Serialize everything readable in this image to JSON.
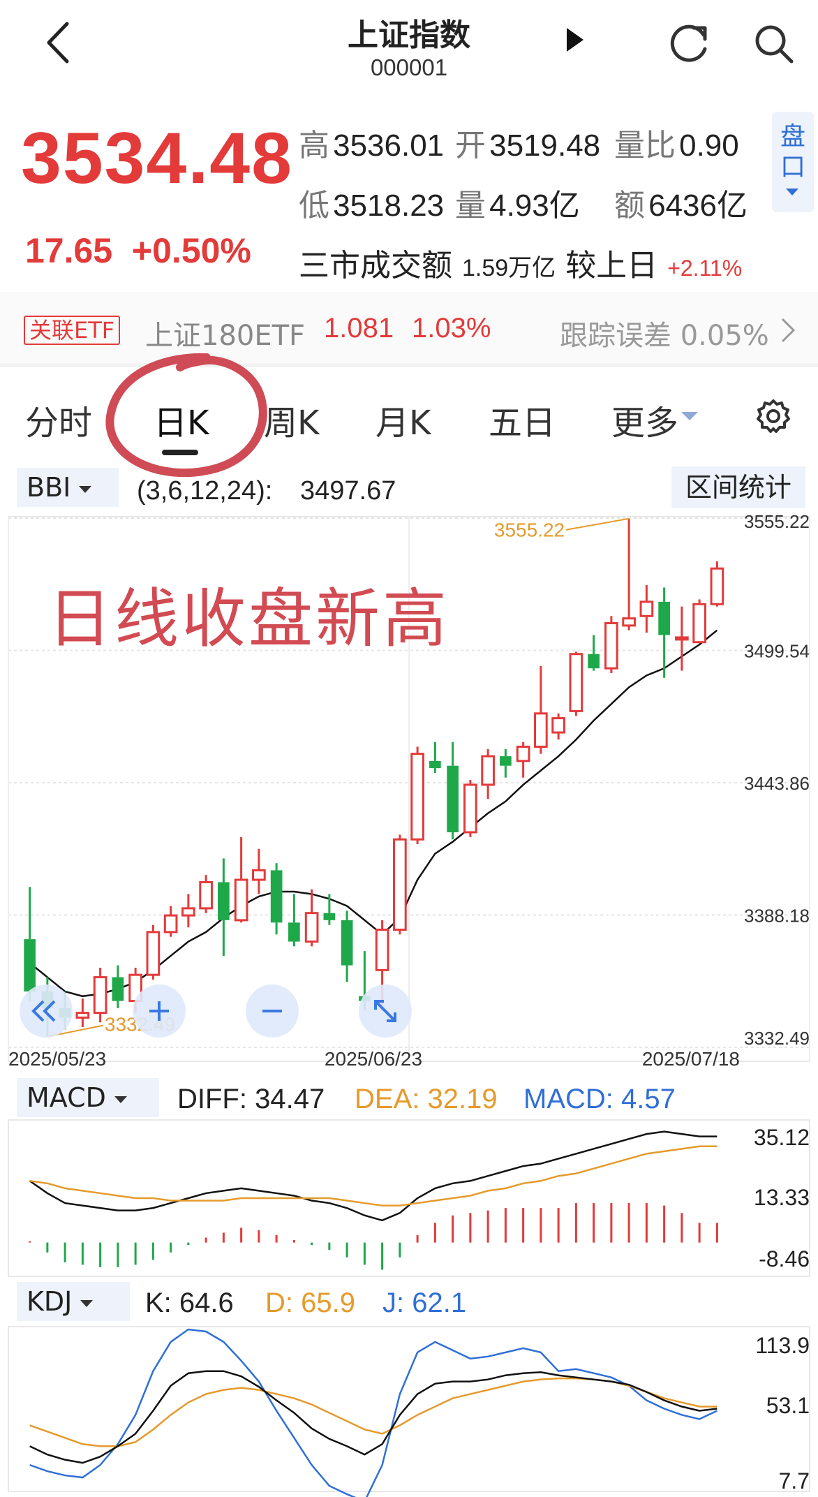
{
  "header": {
    "title": "上证指数",
    "code": "000001"
  },
  "quote": {
    "price": "3534.48",
    "change": "17.65",
    "change_pct": "+0.50%",
    "high_label": "高",
    "high": "3536.01",
    "open_label": "开",
    "open": "3519.48",
    "vol_ratio_label": "量比",
    "vol_ratio": "0.90",
    "low_label": "低",
    "low": "3518.23",
    "volume_label": "量",
    "volume": "4.93亿",
    "amount_label": "额",
    "amount": "6436亿",
    "turnover_label": "三市成交额",
    "turnover_value": "1.59万亿",
    "vs_prev_label": "较上日",
    "vs_prev_value": "+2.11%",
    "pankou_label": "盘口"
  },
  "etf": {
    "tag": "关联ETF",
    "name": "上证180ETF",
    "price": "1.081",
    "pct": "1.03%",
    "tracking_error": "跟踪误差 0.05%"
  },
  "tabs": [
    {
      "label": "分时"
    },
    {
      "label": "日K",
      "active": true
    },
    {
      "label": "周K"
    },
    {
      "label": "月K"
    },
    {
      "label": "五日"
    },
    {
      "label": "更多"
    }
  ],
  "bbi": {
    "name": "BBI",
    "params": "(3,6,12,24):",
    "value": "3497.67",
    "range_button": "区间统计"
  },
  "annotation": "日线收盘新高",
  "macd_panel": {
    "name": "MACD",
    "diff": "DIFF: 34.47",
    "dea": "DEA: 32.19",
    "macd": "MACD: 4.57"
  },
  "kdj_panel": {
    "name": "KDJ",
    "k": "K: 64.6",
    "d": "D: 65.9",
    "j": "J: 62.1"
  },
  "colors": {
    "up": "#e33a3a",
    "down": "#1fa84a",
    "accent": "#2f6fd6",
    "orange": "#e59a2b"
  },
  "chart_data": [
    {
      "type": "candlestick",
      "ylim": [
        3332.49,
        3555.22
      ],
      "yticks": [
        "3555.22",
        "3499.54",
        "3443.86",
        "3388.18",
        "3332.49"
      ],
      "xticks": [
        "2025/05/23",
        "2025/06/23",
        "2025/07/18"
      ],
      "max_label": "3555.22",
      "min_label": "3332.49",
      "candles": [
        [
          3378,
          3356,
          3400,
          3352
        ],
        [
          3356,
          3349,
          3362,
          3337
        ],
        [
          3349,
          3345,
          3356,
          3340
        ],
        [
          3345,
          3347,
          3353,
          3341
        ],
        [
          3347,
          3362,
          3366,
          3343
        ],
        [
          3362,
          3352,
          3367,
          3349
        ],
        [
          3352,
          3363,
          3366,
          3347
        ],
        [
          3363,
          3381,
          3384,
          3361
        ],
        [
          3381,
          3388,
          3392,
          3379
        ],
        [
          3388,
          3391,
          3397,
          3383
        ],
        [
          3391,
          3402,
          3405,
          3389
        ],
        [
          3402,
          3386,
          3412,
          3371
        ],
        [
          3386,
          3403,
          3421,
          3385
        ],
        [
          3403,
          3407,
          3416,
          3397
        ],
        [
          3407,
          3385,
          3410,
          3380
        ],
        [
          3385,
          3377,
          3397,
          3375
        ],
        [
          3377,
          3389,
          3399,
          3375
        ],
        [
          3389,
          3386,
          3397,
          3384
        ],
        [
          3386,
          3367,
          3390,
          3360
        ],
        [
          3354,
          3352,
          3373,
          3348
        ],
        [
          3365,
          3382,
          3386,
          3348
        ],
        [
          3382,
          3420,
          3422,
          3380
        ],
        [
          3420,
          3456,
          3459,
          3418
        ],
        [
          3453,
          3450,
          3461,
          3448
        ],
        [
          3451,
          3423,
          3461,
          3420
        ],
        [
          3423,
          3443,
          3445,
          3421
        ],
        [
          3443,
          3455,
          3458,
          3437
        ],
        [
          3455,
          3451,
          3458,
          3446
        ],
        [
          3453,
          3459,
          3461,
          3446
        ],
        [
          3459,
          3473,
          3493,
          3456
        ],
        [
          3465,
          3471,
          3473,
          3462
        ],
        [
          3474,
          3498,
          3499,
          3472
        ],
        [
          3498,
          3492,
          3506,
          3491
        ],
        [
          3492,
          3511,
          3514,
          3490
        ],
        [
          3510,
          3513,
          3555,
          3508
        ],
        [
          3514,
          3520,
          3527,
          3507
        ],
        [
          3520,
          3506,
          3526,
          3488
        ],
        [
          3505,
          3505,
          3518,
          3491
        ],
        [
          3503,
          3519,
          3521,
          3503
        ],
        [
          3519,
          3534,
          3537,
          3518
        ]
      ],
      "bbi_line": [
        3368,
        3362,
        3356,
        3354,
        3355,
        3357,
        3360,
        3365,
        3371,
        3377,
        3381,
        3387,
        3392,
        3396,
        3398,
        3398,
        3397,
        3395,
        3392,
        3386,
        3380,
        3387,
        3403,
        3414,
        3419,
        3425,
        3431,
        3436,
        3443,
        3449,
        3455,
        3462,
        3470,
        3477,
        3484,
        3489,
        3492,
        3497,
        3502,
        3508
      ]
    },
    {
      "type": "line",
      "name": "MACD",
      "yticks": [
        "35.12",
        "13.33",
        "-8.46"
      ],
      "ylim": [
        -12,
        48
      ],
      "diff": [
        25,
        20,
        16,
        15,
        14,
        13,
        13,
        14,
        16,
        18,
        20,
        21,
        22,
        21,
        20,
        19,
        17,
        16,
        14,
        11,
        9,
        12,
        18,
        22,
        24,
        25,
        27,
        29,
        31,
        32,
        34,
        36,
        38,
        40,
        42,
        44,
        45,
        44,
        43,
        43
      ],
      "dea": [
        25,
        24,
        22,
        21,
        20,
        19,
        18,
        18,
        17,
        17,
        17,
        17,
        18,
        18,
        18,
        18,
        18,
        18,
        17,
        16,
        15,
        15,
        16,
        17,
        18,
        19,
        21,
        22,
        24,
        25,
        27,
        28,
        30,
        32,
        34,
        36,
        37,
        38,
        39,
        39
      ],
      "macd": [
        0,
        -4,
        -8,
        -9,
        -10,
        -10,
        -9,
        -7,
        -4,
        -1,
        2,
        4,
        6,
        5,
        3,
        1,
        -1,
        -3,
        -6,
        -9,
        -11,
        -6,
        3,
        8,
        11,
        12,
        13,
        14,
        14,
        14,
        14,
        16,
        16,
        16,
        16,
        16,
        15,
        12,
        8,
        8
      ]
    },
    {
      "type": "line",
      "name": "KDJ",
      "yticks": [
        "113.9",
        "53.1",
        "7.7"
      ],
      "ylim": [
        -10,
        140
      ],
      "k": [
        28,
        20,
        15,
        12,
        18,
        28,
        40,
        62,
        86,
        98,
        100,
        100,
        95,
        85,
        72,
        60,
        45,
        35,
        28,
        20,
        30,
        58,
        78,
        88,
        90,
        90,
        92,
        96,
        98,
        99,
        96,
        94,
        92,
        90,
        87,
        80,
        72,
        66,
        62,
        64
      ],
      "d": [
        48,
        42,
        36,
        30,
        28,
        28,
        32,
        44,
        58,
        70,
        78,
        82,
        84,
        82,
        78,
        74,
        68,
        60,
        52,
        44,
        40,
        48,
        58,
        66,
        74,
        78,
        82,
        86,
        90,
        92,
        93,
        93,
        92,
        90,
        86,
        80,
        74,
        70,
        66,
        66
      ],
      "j": [
        10,
        4,
        0,
        -2,
        10,
        30,
        58,
        100,
        128,
        140,
        138,
        128,
        110,
        90,
        62,
        36,
        10,
        -10,
        -18,
        -25,
        10,
        78,
        118,
        128,
        120,
        112,
        114,
        118,
        122,
        118,
        100,
        102,
        98,
        94,
        86,
        72,
        64,
        58,
        54,
        62
      ]
    }
  ]
}
